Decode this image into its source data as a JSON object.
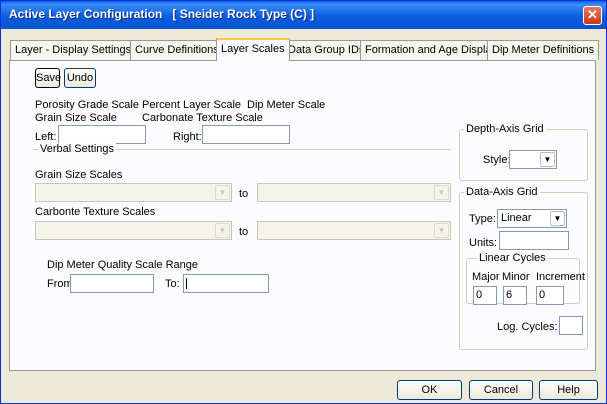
{
  "window": {
    "title": "Active Layer Configuration   [ Sneider Rock Type (C) ]"
  },
  "tabs": [
    "Layer - Display Settings",
    "Curve Definitions",
    "Layer Scales",
    "Data Group IDs",
    "Formation and Age Display",
    "Dip Meter Definitions"
  ],
  "toolbar": {
    "save": "Save",
    "undo": "Undo"
  },
  "scales": {
    "porosity": "Porosity Grade Scale",
    "percent": "Percent Layer Scale",
    "dip": "Dip Meter Scale",
    "grain": "Grain Size Scale",
    "carbonate": "Carbonate Texture Scale",
    "left_label": "Left:",
    "right_label": "Right:",
    "left_value": "",
    "right_value": ""
  },
  "verbal": {
    "title": "Verbal Settings",
    "grain_label": "Grain Size Scales",
    "carbonate_label": "Carbonte Texture Scales",
    "to": "to"
  },
  "dip_quality": {
    "title": "Dip Meter Quality Scale Range",
    "from_label": "From:",
    "to_label": "To:",
    "from_value": "",
    "to_value": ""
  },
  "depth_axis": {
    "title": "Depth-Axis Grid",
    "style_label": "Style:",
    "style_value": ""
  },
  "data_axis": {
    "title": "Data-Axis Grid",
    "type_label": "Type:",
    "type_value": "Linear",
    "units_label": "Units:",
    "units_value": "",
    "linear_title": "Linear Cycles",
    "major_label": "Major",
    "minor_label": "Minor",
    "increment_label": "Increment",
    "major_value": "0",
    "minor_value": "6",
    "increment_value": "0",
    "log_label": "Log. Cycles:",
    "log_value": ""
  },
  "footer": {
    "ok": "OK",
    "cancel": "Cancel",
    "help": "Help"
  },
  "colors": {
    "titlebar": "#0a5ee0",
    "close": "#c7381b",
    "active_tab_accent": "#ffc83c",
    "face": "#ece9d8"
  }
}
